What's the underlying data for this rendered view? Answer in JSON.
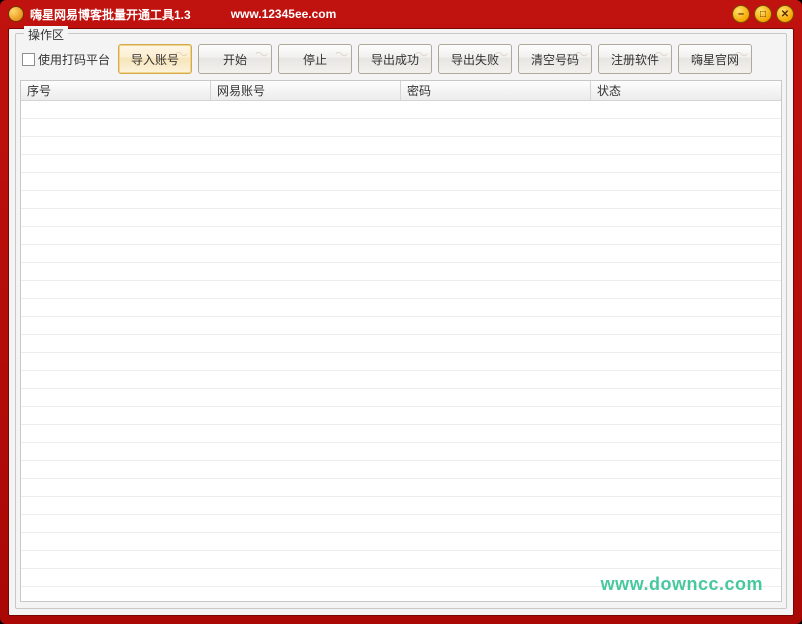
{
  "titlebar": {
    "title": "嗨星网易博客批量开通工具1.3",
    "url": "www.12345ee.com"
  },
  "groupbox": {
    "label": "操作区"
  },
  "checkbox": {
    "label": "使用打码平台",
    "checked": false
  },
  "buttons": {
    "import": "导入账号",
    "start": "开始",
    "stop": "停止",
    "export_success": "导出成功",
    "export_fail": "导出失败",
    "clear": "清空号码",
    "register": "注册软件",
    "website": "嗨星官网"
  },
  "columns": {
    "index": "序号",
    "account": "网易账号",
    "password": "密码",
    "status": "状态"
  },
  "rows": [],
  "watermark": "www.downcc.com"
}
